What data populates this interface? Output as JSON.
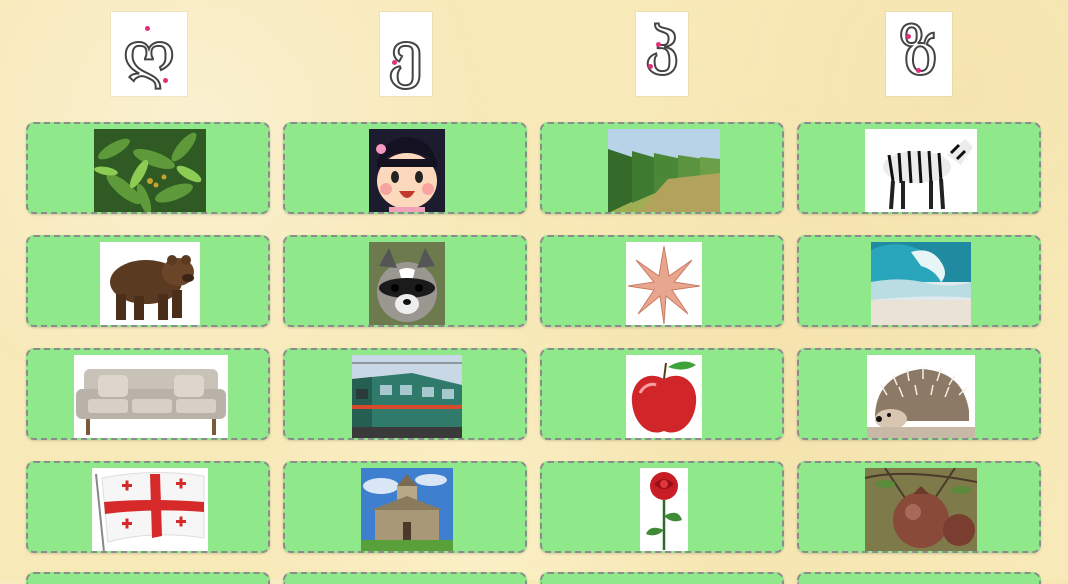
{
  "letters": [
    {
      "glyph": "ღ",
      "name": "letter-ghani"
    },
    {
      "glyph": "ე",
      "name": "letter-e"
    },
    {
      "glyph": "პ",
      "name": "letter-par"
    },
    {
      "glyph": "ზ",
      "name": "letter-zen"
    }
  ],
  "cards": [
    [
      "laurel-leaves",
      "girl-face",
      "vineyard",
      "zebra"
    ],
    [
      "bear",
      "raccoon",
      "star",
      "sea-wave"
    ],
    [
      "sofa",
      "train",
      "apple",
      "hedgehog"
    ],
    [
      "georgian-flag",
      "church",
      "rose",
      "pomegranate"
    ]
  ],
  "colors": {
    "background": "#f8e9b8",
    "card": "#8fe889",
    "card_border": "#8c8c8c",
    "trace_guide": "#e0307a"
  }
}
